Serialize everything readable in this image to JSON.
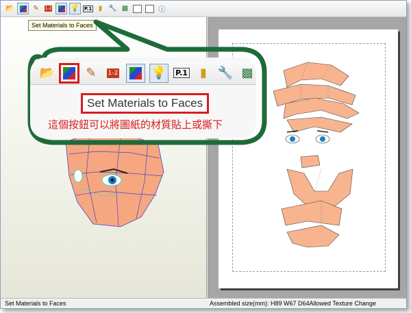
{
  "toolbar": {
    "icons": [
      "open-icon",
      "materials-icon",
      "brush-icon",
      "number-icon",
      "cube-icon",
      "bulb-icon",
      "page-number-icon",
      "fold-icon",
      "wrench-icon",
      "print-icon",
      "window-icon",
      "window2-icon",
      "info-icon"
    ],
    "page_number_label": "P.1",
    "number_label": "1-2"
  },
  "tooltip": {
    "text": "Set Materials to Faces"
  },
  "callout": {
    "tooltip_text": "Set Materials to Faces",
    "note": "這個按鈕可以將圖紙的材質貼上或撕下",
    "page_number_label": "P.1",
    "number_label": "1-2"
  },
  "status": {
    "left": "Set Materials to Faces",
    "right": "Assembled size(mm): H89 W67 D64Allowed Texture Change"
  },
  "colors": {
    "accent_red": "#d91c1c",
    "callout_green": "#1e6b3a",
    "skin": "#f7b48e"
  }
}
